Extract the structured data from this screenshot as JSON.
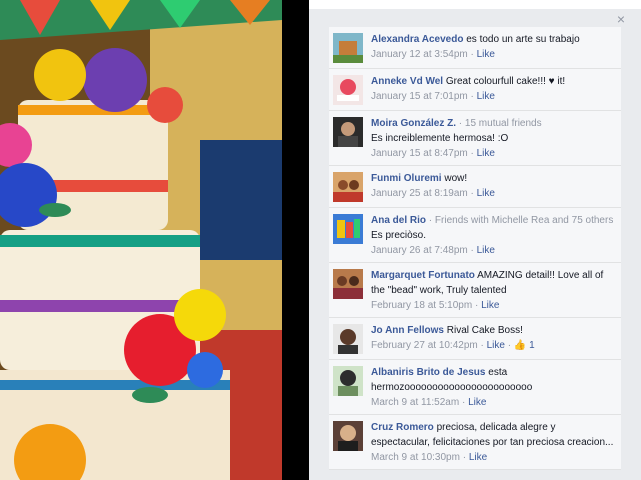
{
  "close_label": "×",
  "comments": [
    {
      "name": "Alexandra Acevedo",
      "extra": "",
      "body": "es todo un arte su trabajo",
      "date": "January 12 at 3:54pm",
      "like": "Like",
      "likes": ""
    },
    {
      "name": "Anneke Vd Wel",
      "extra": "",
      "body": "Great colourfull cake!!! ♥ it!",
      "date": "January 15 at 7:01pm",
      "like": "Like",
      "likes": ""
    },
    {
      "name": "Moira González Z.",
      "extra": "· 15 mutual friends",
      "body": "Es increiblemente hermosa! :O",
      "date": "January 15 at 8:47pm",
      "like": "Like",
      "likes": ""
    },
    {
      "name": "Funmi Oluremi",
      "extra": "",
      "body": "wow!",
      "date": "January 25 at 8:19am",
      "like": "Like",
      "likes": ""
    },
    {
      "name": "Ana del Rio",
      "extra": "· Friends with Michelle Rea and 75 others",
      "body": "Es preciòso.",
      "date": "January 26 at 7:48pm",
      "like": "Like",
      "likes": ""
    },
    {
      "name": "Margarquet Fortunato",
      "extra": "",
      "body": "AMAZING detail!! Love all of the \"bead\" work, Truly talented",
      "date": "February 18 at 5:10pm",
      "like": "Like",
      "likes": ""
    },
    {
      "name": "Jo Ann Fellows",
      "extra": "",
      "body": "Rival Cake Boss!",
      "date": "February 27 at 10:42pm",
      "like": "Like",
      "likes": "1"
    },
    {
      "name": "Albaniris Brito de Jesus",
      "extra": "",
      "body": "esta hermozooooooooooooooooooooooo",
      "date": "March 9 at 11:52am",
      "like": "Like",
      "likes": ""
    },
    {
      "name": "Cruz Romero",
      "extra": "",
      "body": "preciosa, delicada alegre y espectacular, felicitaciones por tan preciosa creacion...",
      "date": "March 9 at 10:30pm",
      "like": "Like",
      "likes": ""
    }
  ],
  "colors": {
    "link": "#3b5998",
    "muted": "#9197a3",
    "panel": "#e9ebee",
    "card": "#f6f7f9"
  }
}
